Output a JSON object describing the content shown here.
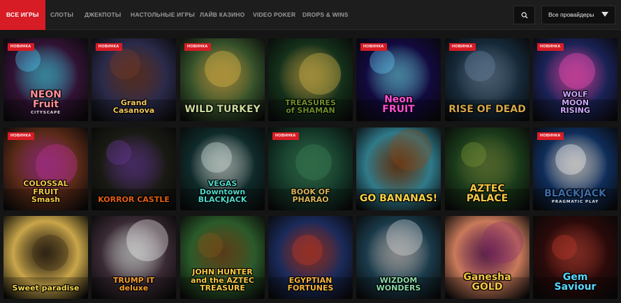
{
  "nav": {
    "tabs": [
      {
        "label": "ВСЕ ИГРЫ",
        "active": true
      },
      {
        "label": "СЛОТЫ"
      },
      {
        "label": "ДЖЕКПОТЫ"
      },
      {
        "label": "НАСТОЛЬНЫЕ ИГРЫ"
      },
      {
        "label": "ЛАЙВ КАЗИНО"
      },
      {
        "label": "VIDEO POKER"
      },
      {
        "label": "DROPS & WINS"
      }
    ],
    "search_icon": "search-icon",
    "provider_select": {
      "value": "Все провайдеры",
      "icon": "chevron-down-icon"
    }
  },
  "badge_label": "НОВИНКА",
  "games": [
    {
      "title": "NEON\nFruit",
      "subtitle": "CITYSCAPE",
      "new": true,
      "colors": [
        "#311334",
        "#ff8f9b",
        "#4fd8ff"
      ]
    },
    {
      "title": "Grand\nCasanova",
      "new": true,
      "colors": [
        "#2a2a4a",
        "#f0c65a",
        "#7b3d2a"
      ]
    },
    {
      "title": "WILD TURKEY",
      "new": true,
      "colors": [
        "#35512a",
        "#c9d89a",
        "#e8c04a"
      ]
    },
    {
      "title": "TREASURES\nof SHAMAN",
      "new": false,
      "colors": [
        "#14301a",
        "#6e8c2a",
        "#d6b94a"
      ]
    },
    {
      "title": "Neon\nFRUIT",
      "new": true,
      "colors": [
        "#120a3e",
        "#ff4fd8",
        "#6ad3ff"
      ]
    },
    {
      "title": "RISE OF DEAD",
      "new": true,
      "colors": [
        "#162a3a",
        "#d2a64a",
        "#6c8aa8"
      ]
    },
    {
      "title": "WOLF\nMOON\nRISING",
      "new": true,
      "colors": [
        "#1a2256",
        "#c9a6ff",
        "#ff4fc4"
      ]
    },
    {
      "title": "COLOSSAL\nFRUIT\nSmash",
      "new": true,
      "colors": [
        "#5a2a18",
        "#f5c843",
        "#c5359a"
      ]
    },
    {
      "title": "KORROR CASTLE",
      "new": false,
      "colors": [
        "#1a1a14",
        "#e25d13",
        "#6a3a9a"
      ]
    },
    {
      "title": "VEGAS\nDowntown\nBLACKJACK",
      "new": false,
      "colors": [
        "#0f2a2a",
        "#4fd8c8",
        "#e0f0ea"
      ]
    },
    {
      "title": "BOOK OF\nPHARAO",
      "new": true,
      "colors": [
        "#143a2a",
        "#d6b45a",
        "#3a8a5a"
      ]
    },
    {
      "title": "GO BANANAS!",
      "new": false,
      "colors": [
        "#2f7a8a",
        "#f5d043",
        "#8a4a1a"
      ]
    },
    {
      "title": "AZTEC\nPALACE",
      "new": false,
      "colors": [
        "#1a3a1a",
        "#f5c843",
        "#7a9a3a"
      ]
    },
    {
      "title": "BLACKJACK",
      "subtitle": "PRAGMATIC PLAY",
      "new": true,
      "colors": [
        "#0f2d5a",
        "#3a6aa8",
        "#ffffff"
      ]
    },
    {
      "title": "Sweet paradise",
      "new": false,
      "colors": [
        "#c9a64a",
        "#f5d64a",
        "#3a2a14"
      ]
    },
    {
      "title": "TRUMP IT\ndeluxe",
      "new": false,
      "colors": [
        "#3a2a34",
        "#f5a02a",
        "#ffffff"
      ]
    },
    {
      "title": "JOHN HUNTER\nand the AZTEC\nTREASURE",
      "new": false,
      "colors": [
        "#2a5a2a",
        "#f5c843",
        "#8a5a1a"
      ]
    },
    {
      "title": "EGYPTIAN\nFORTUNES",
      "new": false,
      "colors": [
        "#1a2a5a",
        "#f5b43a",
        "#c53a2a"
      ]
    },
    {
      "title": "WIZDOM\nWONDERS",
      "new": false,
      "colors": [
        "#1a3a4a",
        "#8ad8a8",
        "#e0e0e0"
      ]
    },
    {
      "title": "Ganesha\nGOLD",
      "new": false,
      "colors": [
        "#c97a5a",
        "#f5c843",
        "#8a2a6a"
      ]
    },
    {
      "title": "Gem\nSaviour",
      "new": false,
      "colors": [
        "#2a0a0a",
        "#5ad8ff",
        "#c53a2a"
      ]
    }
  ]
}
